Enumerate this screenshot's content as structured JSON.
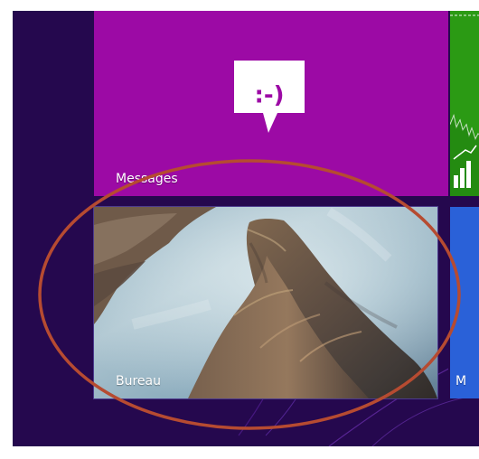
{
  "colors": {
    "background": "#25084e",
    "messages_tile": "#9c0aa5",
    "finance_tile": "#2b9a14",
    "blue_tile": "#2a61d8",
    "annotation": "#b64b31"
  },
  "tiles": {
    "messages": {
      "label": "Messages",
      "icon": "chat-bubble-smiley-icon",
      "glyph": ":-)"
    },
    "desktop": {
      "label": "Bureau"
    },
    "blue": {
      "label": "M"
    },
    "finance": {
      "icon": "bar-chart-icon"
    }
  }
}
